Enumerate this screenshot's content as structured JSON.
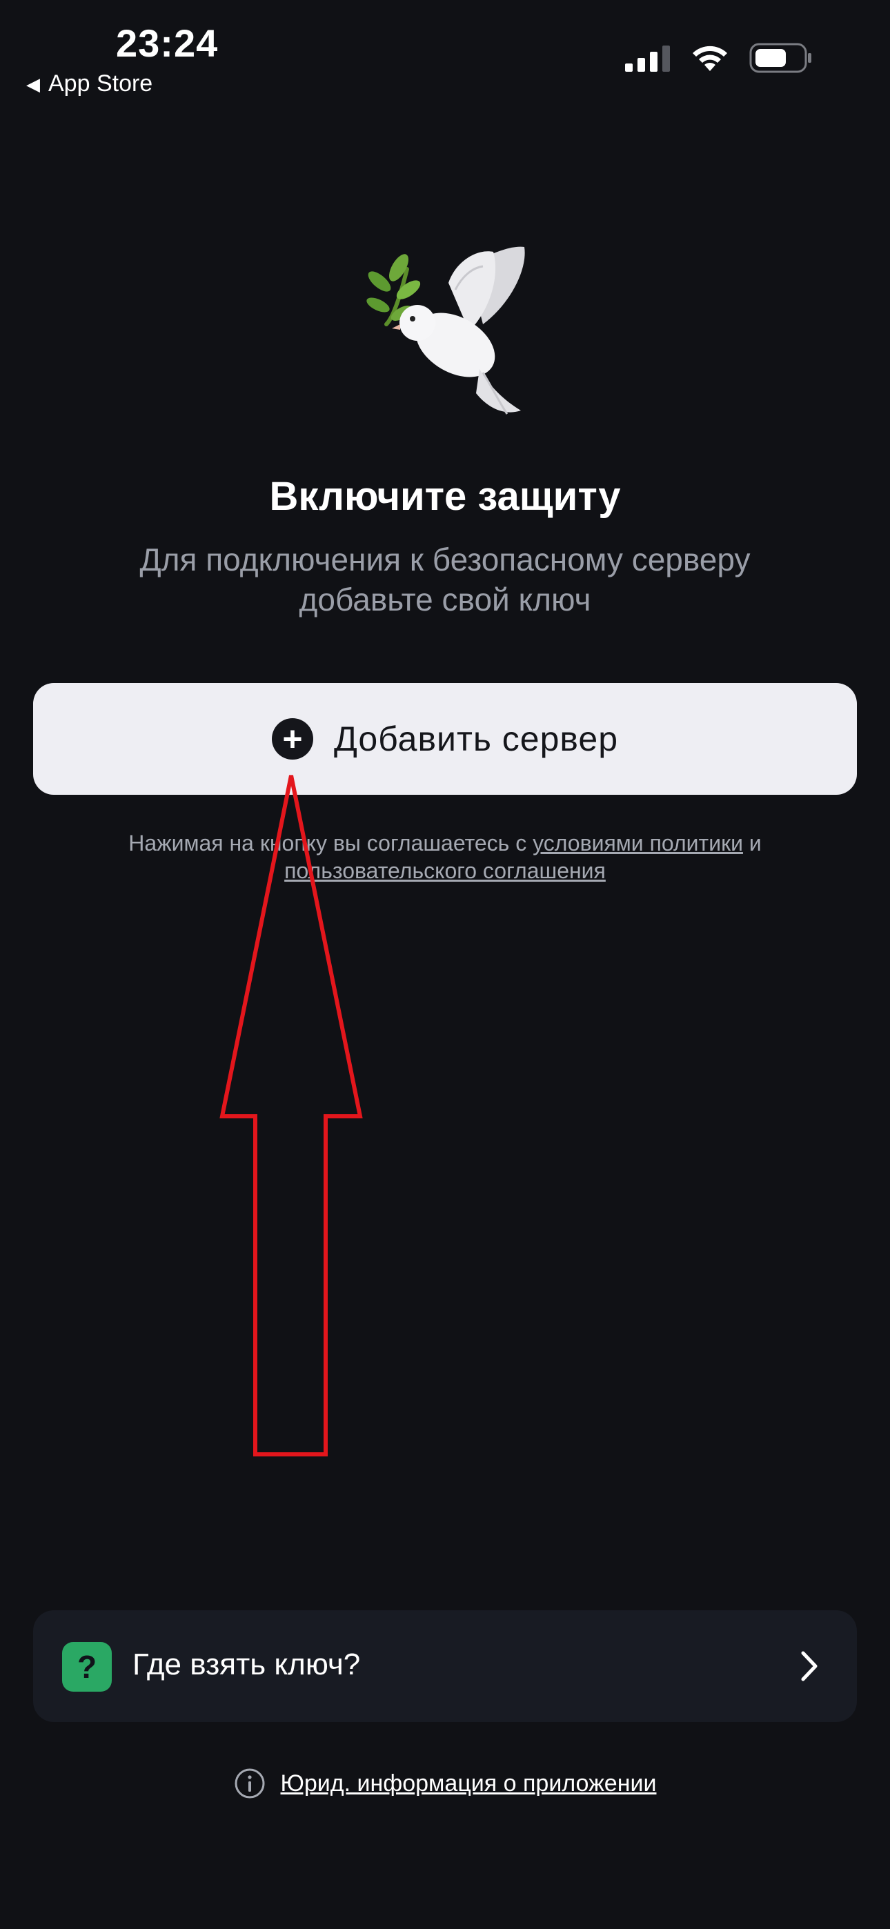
{
  "status_bar": {
    "time": "23:24",
    "back_label": "App Store",
    "back_arrow_icon": "triangle-left-icon",
    "signal_icon": "cellular-signal-icon",
    "wifi_icon": "wifi-icon",
    "battery_icon": "battery-icon"
  },
  "hero": {
    "icon": "dove-icon",
    "title": "Включите защиту",
    "subtitle": "Для подключения к безопасному серверу добавьте свой ключ"
  },
  "add_button": {
    "icon": "plus-circle-icon",
    "label": "Добавить сервер"
  },
  "terms": {
    "prefix": "Нажимая на кнопку вы соглашаетесь с ",
    "policy_link": "условиями политики",
    "middle": " и ",
    "agreement_link": "пользовательского соглашения"
  },
  "key_card": {
    "icon": "question-icon",
    "icon_text": "?",
    "label": "Где взять ключ?",
    "chevron": "chevron-right-icon"
  },
  "legal": {
    "icon": "info-icon",
    "label": "Юрид. информация о приложении"
  },
  "colors": {
    "background": "#101115",
    "button_bg": "#eeeef3",
    "card_bg": "#181b23",
    "accent_green": "#2aa864",
    "annotation_red": "#e3161c"
  }
}
